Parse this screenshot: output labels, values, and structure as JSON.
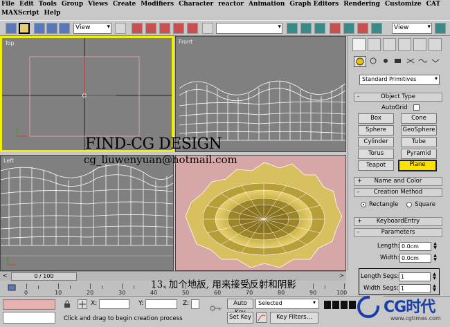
{
  "menu": {
    "row1": [
      "File",
      "Edit",
      "Tools",
      "Group",
      "Views",
      "Create",
      "Modifiers",
      "Character",
      "reactor",
      "Animation",
      "Graph Editors",
      "Rendering",
      "Customize",
      "CAT"
    ],
    "row2": [
      "MAXScript",
      "Help"
    ]
  },
  "toolbar": {
    "view_select_1": "View",
    "view_select_2": "View",
    "named_selection": ""
  },
  "viewports": {
    "top": "Top",
    "front": "Front",
    "left": "Left"
  },
  "command_panel": {
    "category": "Standard Primitives",
    "object_type": "Object Type",
    "autogrid": "AutoGrid",
    "buttons": [
      "Box",
      "Cone",
      "Sphere",
      "GeoSphere",
      "Cylinder",
      "Tube",
      "Torus",
      "Pyramid",
      "Teapot",
      "Plane"
    ],
    "name_and_color": "Name and Color",
    "creation_method": "Creation Method",
    "method_rectangle": "Rectangle",
    "method_square": "Square",
    "keyboard_entry": "KeyboardEntry",
    "parameters": "Parameters",
    "length_label": "Length:",
    "length_value": "0.0cm",
    "width_label": "Width:",
    "width_value": "0.0cm",
    "length_segs_label": "Length Segs:",
    "length_segs_value": "1",
    "width_segs_label": "Width Segs:",
    "width_segs_value": "1"
  },
  "timeline": {
    "slider": "0 / 100",
    "ticks": [
      "0",
      "10",
      "20",
      "30",
      "40",
      "50",
      "60",
      "70",
      "80",
      "90",
      "100"
    ]
  },
  "status": {
    "x_label": "X:",
    "y_label": "Y:",
    "z_label": "Z:",
    "auto_key": "Auto Key",
    "set_key": "Set Key",
    "selected": "Selected",
    "key_filters": "Key Filters...",
    "prompt": "Click and drag to begin creation process"
  },
  "overlay": {
    "title": "FIND-CG DESIGN",
    "email": "cg_liuwenyuan@hotmail.com",
    "caption": "13. 加个地板, 用来接受反射和阴影"
  },
  "watermark": {
    "text": "CG时代",
    "url": "www.cgtimes.com"
  },
  "colors": {
    "active_viewport_border": "#f0f000",
    "active_button": "#ffe000",
    "object_gold": "#c8b040",
    "perspective_bg": "#d7a7a7"
  }
}
